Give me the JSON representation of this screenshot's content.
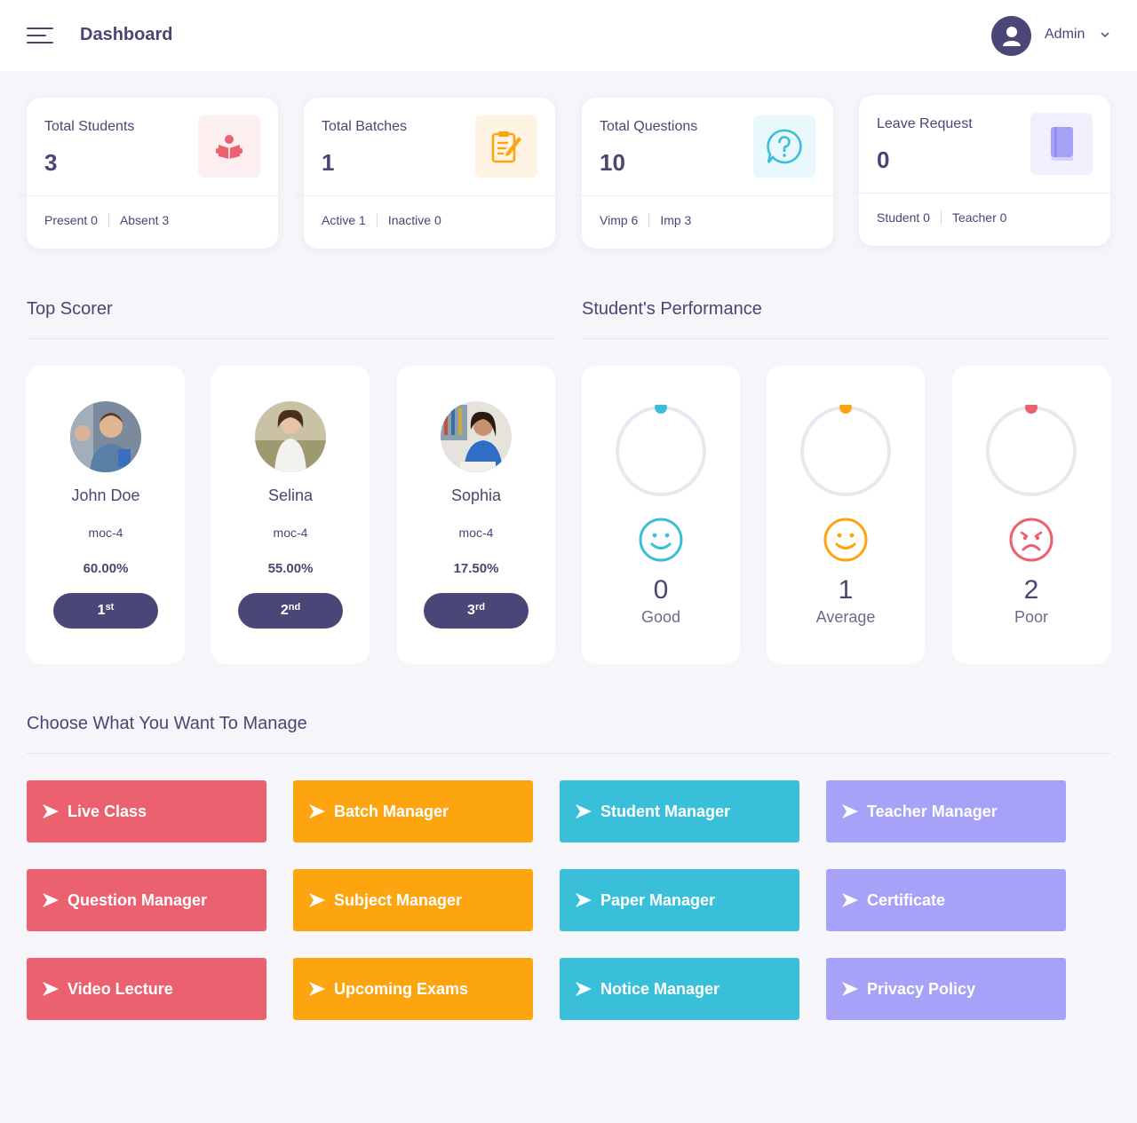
{
  "header": {
    "title": "Dashboard",
    "user_name": "Admin"
  },
  "stats": [
    {
      "label": "Total Students",
      "value": "3",
      "foot_left": "Present 0",
      "foot_right": "Absent 3",
      "icon": "student-reading-icon",
      "color": "#eb6170"
    },
    {
      "label": "Total Batches",
      "value": "1",
      "foot_left": "Active 1",
      "foot_right": "Inactive 0",
      "icon": "clipboard-edit-icon",
      "color": "#fca510"
    },
    {
      "label": "Total Questions",
      "value": "10",
      "foot_left": "Vimp 6",
      "foot_right": "Imp 3",
      "icon": "question-bubble-icon",
      "color": "#3abfda"
    },
    {
      "label": "Leave Request",
      "value": "0",
      "foot_left": "Student 0",
      "foot_right": "Teacher 0",
      "icon": "book-icon",
      "color": "#a5a2f7"
    }
  ],
  "top_scorer": {
    "title": "Top Scorer",
    "items": [
      {
        "name": "John Doe",
        "batch": "moc-4",
        "percent": "60.00%",
        "rank_num": "1",
        "rank_suffix": "st"
      },
      {
        "name": "Selina",
        "batch": "moc-4",
        "percent": "55.00%",
        "rank_num": "2",
        "rank_suffix": "nd"
      },
      {
        "name": "Sophia",
        "batch": "moc-4",
        "percent": "17.50%",
        "rank_num": "3",
        "rank_suffix": "rd"
      }
    ]
  },
  "performance": {
    "title": "Student's Performance",
    "items": [
      {
        "count": "0",
        "label": "Good",
        "color": "#3abfda",
        "face": "smile-icon"
      },
      {
        "count": "1",
        "label": "Average",
        "color": "#fca510",
        "face": "smile-icon"
      },
      {
        "count": "2",
        "label": "Poor",
        "color": "#eb6170",
        "face": "sad-icon"
      }
    ]
  },
  "manage": {
    "title": "Choose What You Want To Manage",
    "buttons": [
      "Live Class",
      "Batch Manager",
      "Student Manager",
      "Teacher Manager",
      "Question Manager",
      "Subject Manager",
      "Paper Manager",
      "Certificate",
      "Video Lecture",
      "Upcoming Exams",
      "Notice Manager",
      "Privacy Policy"
    ],
    "colors": [
      "#eb6170",
      "#fca510",
      "#3abfda",
      "#a5a2f7"
    ]
  }
}
